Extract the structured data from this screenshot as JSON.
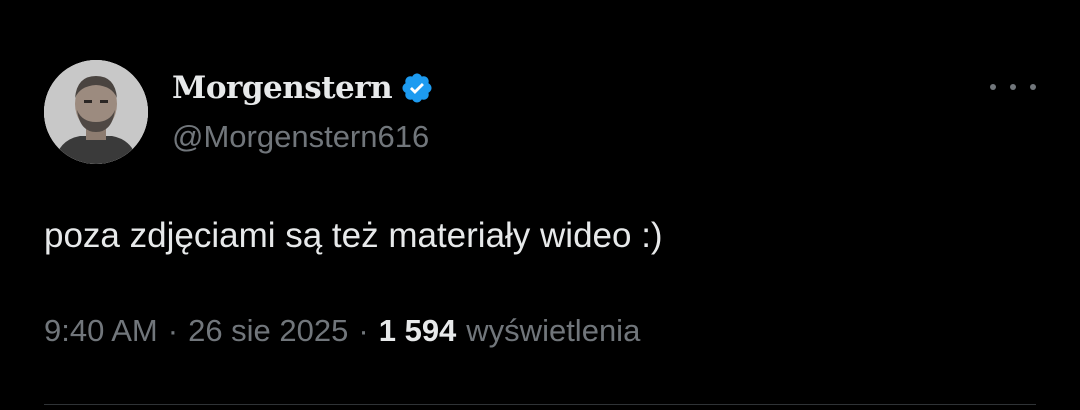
{
  "author": {
    "display_name": "Morgenstern",
    "handle": "@Morgenstern616",
    "verified": true,
    "avatar_icon": "profile-photo-icon"
  },
  "tweet": {
    "text": "poza zdjęciami są też materiały wideo :)",
    "time": "9:40 AM",
    "date": "26 sie 2025",
    "separator": "·",
    "views_count": "1 594",
    "views_label": "wyświetlenia"
  },
  "icons": {
    "verified": "verified-badge-icon",
    "more": "more-options-icon"
  },
  "colors": {
    "background": "#000000",
    "primary_text": "#e7e9ea",
    "secondary_text": "#71767b",
    "verified_blue": "#1d9bf0",
    "divider": "#2f3336"
  }
}
